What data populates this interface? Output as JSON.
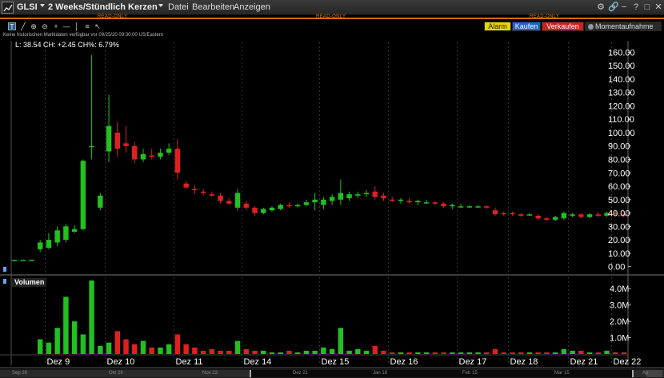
{
  "window": {
    "symbol": "GLSI",
    "period": "2 Weeks/Stündlich Kerzen",
    "menus": [
      "Datei",
      "Bearbeiten",
      "Anzeigen"
    ],
    "read_only": "READ-ONLY"
  },
  "toolbar": {
    "alarm": "Alarm",
    "kaufen": "Kaufen",
    "verkaufen": "Verkaufen",
    "snapshot": "Momentaufnahme"
  },
  "notice": "Keine historischen Marktdaten verfügbar vor 09/25/20 09:30:00 US/Eastern",
  "legend": "L: 38.54 CH: +2.45 CH%: 6.79%",
  "volume_label": "Volumen",
  "navigator": {
    "dates": [
      "Sep 28",
      "Okt 26",
      "Nov 23",
      "Dez 21",
      "Jan 18",
      "Feb 15",
      "Mar 15",
      "Ap"
    ]
  },
  "colors": {
    "up": "#22c022",
    "down": "#e02020",
    "accent": "#d86a00"
  },
  "chart_data": [
    {
      "type": "candlestick",
      "title": "",
      "x_labels": [
        "Dez 9",
        "Dez 10",
        "Dez 11",
        "Dez 14",
        "Dez 15",
        "Dez 16",
        "Dez 17",
        "Dez 18",
        "Dez 21",
        "Dez 22"
      ],
      "y_ticks": [
        0,
        10,
        20,
        30,
        40,
        50,
        60,
        70,
        80,
        90,
        100,
        110,
        120,
        130,
        140,
        150,
        160
      ],
      "ylim": [
        -5,
        165
      ],
      "candles": [
        {
          "o": 5,
          "h": 5,
          "l": 5,
          "c": 5
        },
        {
          "o": 5,
          "h": 5,
          "l": 5,
          "c": 5
        },
        {
          "o": 5,
          "h": 5,
          "l": 5,
          "c": 5
        },
        {
          "o": 13,
          "h": 20,
          "l": 11,
          "c": 18
        },
        {
          "o": 14,
          "h": 25,
          "l": 13,
          "c": 20
        },
        {
          "o": 18,
          "h": 30,
          "l": 15,
          "c": 27
        },
        {
          "o": 20,
          "h": 32,
          "l": 18,
          "c": 30
        },
        {
          "o": 26,
          "h": 31,
          "l": 25,
          "c": 28
        },
        {
          "o": 28,
          "h": 80,
          "l": 27,
          "c": 79
        },
        {
          "o": 90,
          "h": 158,
          "l": 80,
          "c": 90
        },
        {
          "o": 44,
          "h": 55,
          "l": 42,
          "c": 53
        },
        {
          "o": 86,
          "h": 128,
          "l": 78,
          "c": 105
        },
        {
          "o": 100,
          "h": 108,
          "l": 82,
          "c": 88
        },
        {
          "o": 92,
          "h": 105,
          "l": 85,
          "c": 90
        },
        {
          "o": 90,
          "h": 93,
          "l": 77,
          "c": 80
        },
        {
          "o": 80,
          "h": 88,
          "l": 78,
          "c": 84
        },
        {
          "o": 83,
          "h": 88,
          "l": 80,
          "c": 82
        },
        {
          "o": 82,
          "h": 88,
          "l": 80,
          "c": 85
        },
        {
          "o": 85,
          "h": 92,
          "l": 83,
          "c": 88
        },
        {
          "o": 88,
          "h": 95,
          "l": 65,
          "c": 70
        },
        {
          "o": 62,
          "h": 64,
          "l": 58,
          "c": 59
        },
        {
          "o": 58,
          "h": 61,
          "l": 54,
          "c": 57
        },
        {
          "o": 56,
          "h": 58,
          "l": 53,
          "c": 55
        },
        {
          "o": 54,
          "h": 56,
          "l": 52,
          "c": 53
        },
        {
          "o": 53,
          "h": 55,
          "l": 47,
          "c": 49
        },
        {
          "o": 49,
          "h": 51,
          "l": 46,
          "c": 47
        },
        {
          "o": 44,
          "h": 58,
          "l": 42,
          "c": 55
        },
        {
          "o": 47,
          "h": 49,
          "l": 42,
          "c": 44
        },
        {
          "o": 44,
          "h": 45,
          "l": 38,
          "c": 40
        },
        {
          "o": 40,
          "h": 44,
          "l": 39,
          "c": 43
        },
        {
          "o": 42,
          "h": 45,
          "l": 41,
          "c": 44
        },
        {
          "o": 43,
          "h": 47,
          "l": 42,
          "c": 46
        },
        {
          "o": 46,
          "h": 48,
          "l": 44,
          "c": 45
        },
        {
          "o": 45,
          "h": 47,
          "l": 44,
          "c": 46
        },
        {
          "o": 46,
          "h": 50,
          "l": 45,
          "c": 48
        },
        {
          "o": 48,
          "h": 55,
          "l": 42,
          "c": 50
        },
        {
          "o": 46,
          "h": 52,
          "l": 43,
          "c": 50
        },
        {
          "o": 49,
          "h": 54,
          "l": 46,
          "c": 52
        },
        {
          "o": 50,
          "h": 65,
          "l": 46,
          "c": 55
        },
        {
          "o": 51,
          "h": 56,
          "l": 49,
          "c": 54
        },
        {
          "o": 53,
          "h": 56,
          "l": 51,
          "c": 54
        },
        {
          "o": 54,
          "h": 57,
          "l": 52,
          "c": 55
        },
        {
          "o": 56,
          "h": 60,
          "l": 50,
          "c": 52
        },
        {
          "o": 53,
          "h": 55,
          "l": 49,
          "c": 51
        },
        {
          "o": 50,
          "h": 52,
          "l": 48,
          "c": 49
        },
        {
          "o": 49,
          "h": 51,
          "l": 47,
          "c": 50
        },
        {
          "o": 49,
          "h": 51,
          "l": 47,
          "c": 48
        },
        {
          "o": 48,
          "h": 50,
          "l": 46,
          "c": 49
        },
        {
          "o": 48,
          "h": 50,
          "l": 47,
          "c": 48
        },
        {
          "o": 48,
          "h": 49,
          "l": 46,
          "c": 47
        },
        {
          "o": 47,
          "h": 48,
          "l": 44,
          "c": 45
        },
        {
          "o": 45,
          "h": 47,
          "l": 43,
          "c": 46
        },
        {
          "o": 45,
          "h": 47,
          "l": 44,
          "c": 45
        },
        {
          "o": 45,
          "h": 46,
          "l": 44,
          "c": 45
        },
        {
          "o": 45,
          "h": 46,
          "l": 44,
          "c": 45
        },
        {
          "o": 45,
          "h": 46,
          "l": 43,
          "c": 44
        },
        {
          "o": 42,
          "h": 44,
          "l": 38,
          "c": 39
        },
        {
          "o": 40,
          "h": 41,
          "l": 38,
          "c": 39
        },
        {
          "o": 40,
          "h": 41,
          "l": 38,
          "c": 39
        },
        {
          "o": 39,
          "h": 40,
          "l": 37,
          "c": 38
        },
        {
          "o": 39,
          "h": 40,
          "l": 38,
          "c": 39
        },
        {
          "o": 38,
          "h": 39,
          "l": 35,
          "c": 36
        },
        {
          "o": 36,
          "h": 37,
          "l": 34,
          "c": 35
        },
        {
          "o": 35,
          "h": 38,
          "l": 34,
          "c": 37
        },
        {
          "o": 36,
          "h": 41,
          "l": 35,
          "c": 40
        },
        {
          "o": 38,
          "h": 40,
          "l": 37,
          "c": 39
        },
        {
          "o": 39,
          "h": 40,
          "l": 36,
          "c": 37
        },
        {
          "o": 37,
          "h": 40,
          "l": 36,
          "c": 39
        },
        {
          "o": 39,
          "h": 41,
          "l": 37,
          "c": 38
        },
        {
          "o": 38,
          "h": 41,
          "l": 37,
          "c": 40
        },
        {
          "o": 40,
          "h": 42,
          "l": 38,
          "c": 39
        },
        {
          "o": 39,
          "h": 40,
          "l": 37,
          "c": 38
        }
      ]
    },
    {
      "type": "bar",
      "title": "Volumen",
      "y_ticks": [
        "1.0M",
        "2.0M",
        "3.0M",
        "4.0M"
      ],
      "ylim": [
        0,
        4.5
      ],
      "values_m": [
        0,
        0,
        0,
        0.9,
        0.7,
        1.6,
        3.5,
        2.0,
        1.2,
        4.5,
        0.5,
        0.7,
        1.4,
        0.9,
        0.6,
        0.8,
        0.4,
        0.4,
        0.6,
        1.2,
        0.6,
        0.4,
        0.2,
        0.3,
        0.2,
        0.2,
        0.8,
        0.3,
        0.2,
        0.2,
        0.1,
        0.1,
        0.2,
        0.1,
        0.2,
        0.2,
        0.4,
        0.3,
        1.6,
        0.2,
        0.3,
        0.2,
        0.5,
        0.2,
        0.1,
        0.1,
        0.1,
        0.1,
        0.1,
        0.1,
        0.1,
        0.1,
        0.1,
        0.1,
        0.1,
        0.1,
        0.3,
        0.1,
        0.1,
        0.1,
        0.1,
        0.1,
        0.1,
        0.1,
        0.3,
        0.2,
        0.2,
        0.1,
        0.1,
        0.2,
        0.1,
        0.1
      ]
    }
  ]
}
